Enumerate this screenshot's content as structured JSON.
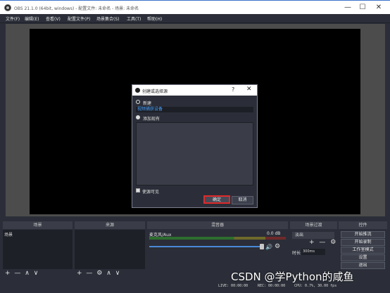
{
  "window": {
    "title": "OBS 21.1.0 (64bit, windows) - 配置文件: 未命名 - 场景: 未命名",
    "minimize": "—",
    "maximize": "☐",
    "close": "✕"
  },
  "menu": [
    "文件(F)",
    "编辑(E)",
    "查看(V)",
    "配置文件(P)",
    "场景集合(S)",
    "工具(T)",
    "帮助(H)"
  ],
  "dialog": {
    "title": "创建或选择源",
    "help": "?",
    "close": "✕",
    "option_new": "新建",
    "name_value": "视频捕获设备",
    "option_existing": "添加现有",
    "visible_label": "使源可见",
    "ok_label": "确定",
    "cancel_label": "取消"
  },
  "docks": {
    "scenes": {
      "header": "场景",
      "item": "场景",
      "footer": [
        "+",
        "—",
        "∧",
        "∨"
      ]
    },
    "sources": {
      "header": "来源",
      "footer": [
        "+",
        "—",
        "⚙",
        "∧",
        "∨"
      ]
    },
    "mixer": {
      "header": "混音器",
      "channel": "麦克风/Aux",
      "level": "0.0 dB"
    },
    "transitions": {
      "header": "场景过渡",
      "selected": "淡出",
      "duration_label": "时长",
      "duration_value": "300ms",
      "footer": [
        "+",
        "—",
        "⚙"
      ]
    },
    "controls": {
      "header": "控件",
      "buttons": [
        "开始推流",
        "开始录制",
        "工作室模式",
        "设置",
        "退出"
      ]
    }
  },
  "status": {
    "live": "LIVE: 00:00:00",
    "rec": "REC: 00:00:00",
    "cpu": "CPU: 0.7%, 30.00 fps"
  },
  "watermark": "CSDN @学Python的咸鱼"
}
